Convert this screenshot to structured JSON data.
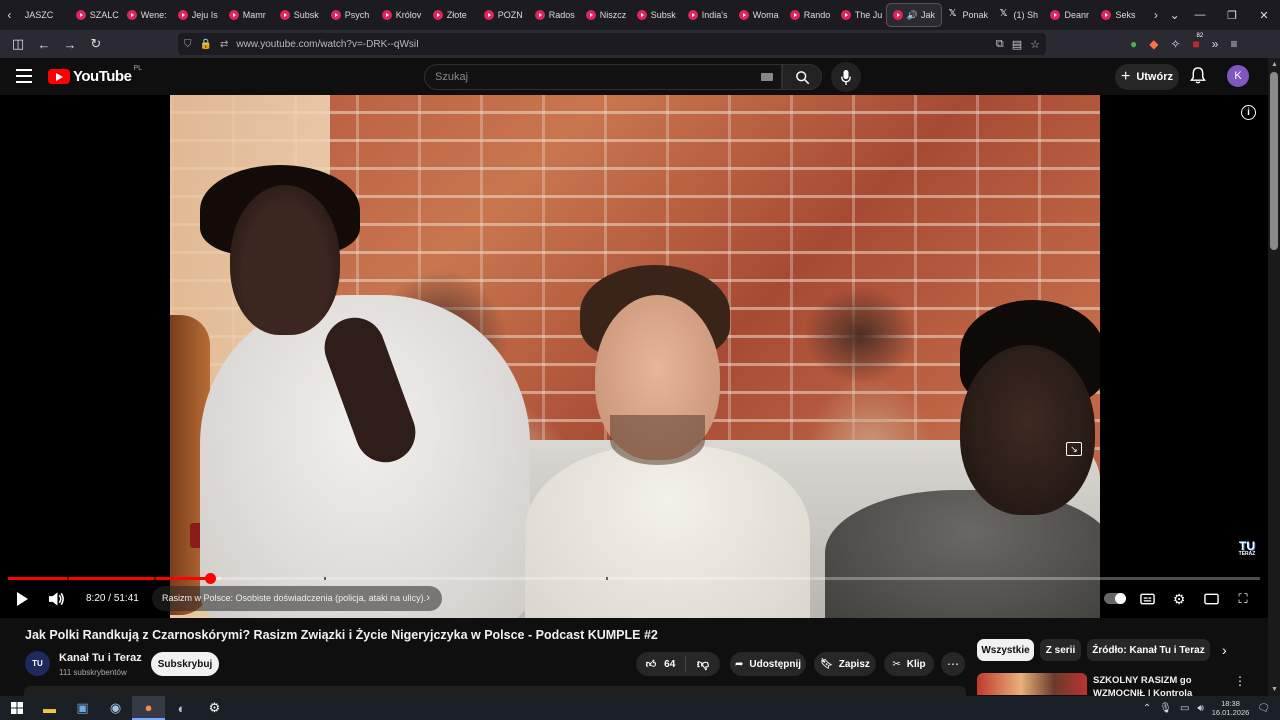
{
  "browser": {
    "tabs": [
      {
        "label": "JASZC",
        "kind": "plain"
      },
      {
        "label": "SZALC",
        "kind": "yt"
      },
      {
        "label": "Wene:",
        "kind": "yt"
      },
      {
        "label": "Jeju Is",
        "kind": "yt"
      },
      {
        "label": "Mamr",
        "kind": "yt"
      },
      {
        "label": "Subsk",
        "kind": "yt"
      },
      {
        "label": "Psych",
        "kind": "yt"
      },
      {
        "label": "Królov",
        "kind": "yt"
      },
      {
        "label": "Złote",
        "kind": "yt"
      },
      {
        "label": "POZN",
        "kind": "yt"
      },
      {
        "label": "Rados",
        "kind": "yt"
      },
      {
        "label": "Niszcz",
        "kind": "yt"
      },
      {
        "label": "Subsk",
        "kind": "yt"
      },
      {
        "label": "India's",
        "kind": "yt"
      },
      {
        "label": "Woma",
        "kind": "yt"
      },
      {
        "label": "Rando",
        "kind": "yt"
      },
      {
        "label": "The Ju",
        "kind": "yt"
      }
    ],
    "active_tab": {
      "label": "Jak"
    },
    "tabs_after": [
      {
        "label": "Ponak",
        "kind": "x"
      },
      {
        "label": "(1) Sh",
        "kind": "x"
      },
      {
        "label": "Deanr",
        "kind": "yt"
      },
      {
        "label": "Seks",
        "kind": "yt"
      }
    ],
    "url": "www.youtube.com/watch?v=-DRK--qWsiI",
    "extension_badge": "82"
  },
  "youtube": {
    "logo_text": "YouTube",
    "region": "PL",
    "search_placeholder": "Szukaj",
    "create_label": "Utwórz",
    "avatar_letter": "K"
  },
  "player": {
    "current_time": "8:20",
    "duration": "51:41",
    "time_separator": "/",
    "played_fraction": 0.161,
    "loaded_fraction": 0.17,
    "chapter_gaps": [
      0.047,
      0.117,
      0.252,
      0.478
    ],
    "chapter_title": "Rasizm w Polsce: Osobiste doświadczenia (policja, ataki na ulicy).",
    "watermark": "TU",
    "watermark_sub": "TERAZ"
  },
  "video": {
    "title": "Jak Polki Randkują z Czarnoskórymi? Rasizm Związki i Życie Nigeryjczyka w Polsce - Podcast KUMPLE #2",
    "channel_name": "Kanał Tu i Teraz",
    "channel_subs": "111 subskrybentów",
    "channel_avatar": "TU",
    "subscribe_label": "Subskrybuj",
    "likes": "64",
    "share_label": "Udostępnij",
    "save_label": "Zapisz",
    "clip_label": "Klip"
  },
  "sidebar": {
    "chips": [
      "Wszystkie",
      "Z serii",
      "Źródło: Kanał Tu i Teraz"
    ],
    "recommended": [
      {
        "title": "SZKOLNY RASIZM go WZMOCNIŁ | Kontrola Oręż..."
      }
    ]
  },
  "taskbar": {
    "time": "18:38",
    "date": "16.01.2026"
  },
  "colors": {
    "accent": "#ff0000",
    "background": "#0f0f0f",
    "browser_chrome": "#2b2a33"
  }
}
